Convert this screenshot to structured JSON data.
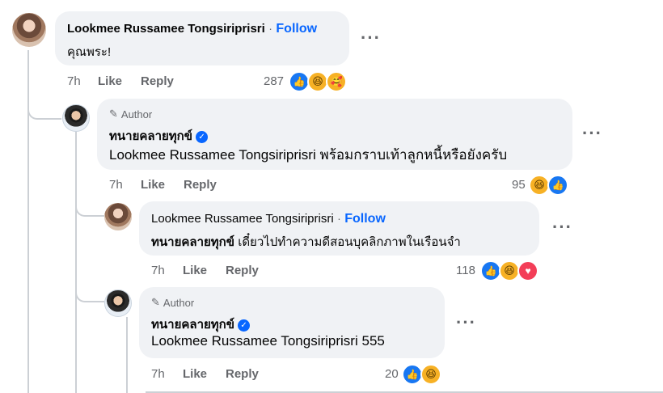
{
  "comments": [
    {
      "author": "Lookmee Russamee Tongsiriprisri",
      "follow": "Follow",
      "separator": "·",
      "text": "คุณพระ!",
      "time": "7h",
      "like": "Like",
      "reply": "Reply",
      "reaction_count": "287",
      "reactions": [
        "like-icon",
        "haha-icon",
        "care-icon"
      ]
    },
    {
      "author_tag": "Author",
      "author": "ทนายคลายทุกข์",
      "verified": "✓",
      "mention": "Lookmee Russamee Tongsiriprisri",
      "text": "พร้อมกราบเท้าลูกหนี้หรือยังครับ",
      "time": "7h",
      "like": "Like",
      "reply": "Reply",
      "reaction_count": "95",
      "reactions": [
        "haha-icon",
        "like-icon"
      ]
    },
    {
      "author": "Lookmee Russamee Tongsiriprisri",
      "follow": "Follow",
      "separator": "·",
      "mention": "ทนายคลายทุกข์",
      "text": "เดี๋ยวไปทำความดีสอนบุคลิกภาพในเรือนจำ",
      "time": "7h",
      "like": "Like",
      "reply": "Reply",
      "reaction_count": "118",
      "reactions": [
        "like-icon",
        "haha-icon",
        "love-icon"
      ]
    },
    {
      "author_tag": "Author",
      "author": "ทนายคลายทุกข์",
      "verified": "✓",
      "mention": "Lookmee Russamee Tongsiriprisri",
      "text": "555",
      "time": "7h",
      "like": "Like",
      "reply": "Reply",
      "reaction_count": "20",
      "reactions": [
        "like-icon",
        "haha-icon"
      ]
    }
  ],
  "more_label": "···",
  "colors": {
    "link": "#0866ff",
    "meta": "#65676b",
    "bubble": "#f0f2f5",
    "like": "#1877f2"
  }
}
